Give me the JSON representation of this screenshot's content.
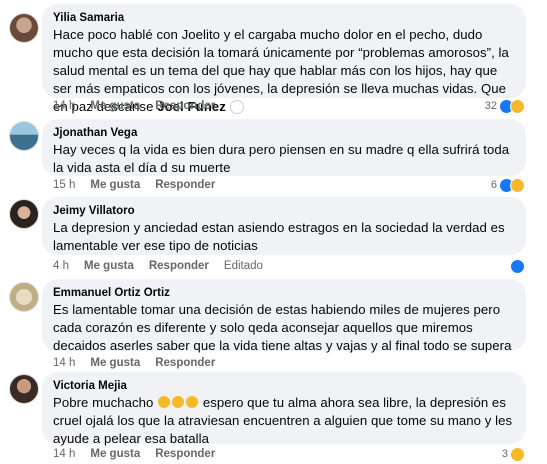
{
  "comments": [
    {
      "author": "Yilia Samaria",
      "text": "Hace poco hablé con Joelito y el cargaba mucho dolor en el pecho, dudo mucho que esta decisión la tomará únicamente por “problemas amorosos”, la salud mental es un tema del que hay que hablar más con los hijos, hay que ser más empaticos con los jóvenes, la depresión se lleva muchas vidas. Que en paz descanse",
      "mention": "Joel Funez",
      "time": "14 h",
      "like": "Me gusta",
      "reply": "Responder",
      "reaction_count": "32",
      "reactions": [
        "like-reaction-icon",
        "sad-reaction-icon"
      ]
    },
    {
      "author": "Jjonathan Vega",
      "text": "Hay veces q la vida es bien dura pero piensen en su madre q ella sufrirá toda la vida asta el día d su muerte",
      "time": "15 h",
      "like": "Me gusta",
      "reply": "Responder",
      "reaction_count": "6",
      "reactions": [
        "like-reaction-icon",
        "sad-reaction-icon"
      ]
    },
    {
      "author": "Jeimy Villatoro",
      "text": "La depresion y anciedad estan asiendo estragos en la sociedad la verdad es lamentable ver ese tipo de noticias",
      "time": "4 h",
      "like": "Me gusta",
      "reply": "Responder",
      "edited": "Editado",
      "reaction_count": "",
      "reactions": [
        "like-reaction-icon"
      ]
    },
    {
      "author": "Emmanuel Ortiz Ortiz",
      "text": "Es lamentable tomar una decisión de estas habiendo miles de mujeres pero cada corazón es diferente y solo qeda aconsejar aquellos que miremos decaidos aserles saber que la vida tiene altas y vajas y al final todo se supera",
      "time": "14 h",
      "like": "Me gusta",
      "reply": "Responder"
    },
    {
      "author": "Victoria Mejia",
      "text_before": "Pobre muchacho",
      "emojis": [
        "grin-sweat-emoji",
        "grin-sweat-emoji",
        "grin-sweat-emoji"
      ],
      "text_after": "espero que tu alma ahora sea libre, la depresión es cruel ojalá los que la atraviesan encuentren a alguien que tome su mano y les ayude a pelear esa batalla",
      "time": "14 h",
      "like": "Me gusta",
      "reply": "Responder",
      "reaction_count": "3",
      "reactions": [
        "sad-reaction-icon"
      ]
    }
  ],
  "colors": {
    "bubble": "#f0f2f5",
    "meta_text": "#65676b",
    "like_blue": "#1877f2",
    "sad_yellow": "#f7b928"
  }
}
